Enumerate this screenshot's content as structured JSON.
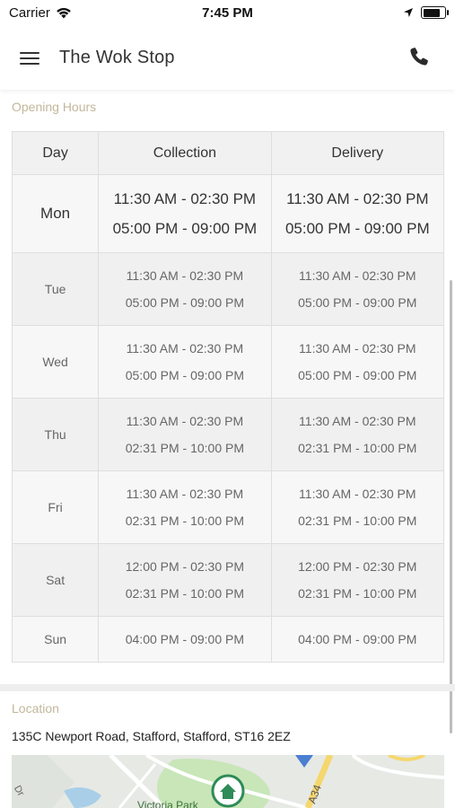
{
  "status_bar": {
    "carrier": "Carrier",
    "time": "7:45 PM",
    "battery_level": 0.9
  },
  "header": {
    "title": "The Wok Stop"
  },
  "opening_hours": {
    "label": "Opening Hours",
    "columns": [
      "Day",
      "Collection",
      "Delivery"
    ],
    "rows": [
      {
        "day": "Mon",
        "collection": [
          "11:30 AM - 02:30 PM",
          "05:00 PM - 09:00 PM"
        ],
        "delivery": [
          "11:30 AM - 02:30 PM",
          "05:00 PM - 09:00 PM"
        ]
      },
      {
        "day": "Tue",
        "collection": [
          "11:30 AM - 02:30 PM",
          "05:00 PM - 09:00 PM"
        ],
        "delivery": [
          "11:30 AM - 02:30 PM",
          "05:00 PM - 09:00 PM"
        ]
      },
      {
        "day": "Wed",
        "collection": [
          "11:30 AM - 02:30 PM",
          "05:00 PM - 09:00 PM"
        ],
        "delivery": [
          "11:30 AM - 02:30 PM",
          "05:00 PM - 09:00 PM"
        ]
      },
      {
        "day": "Thu",
        "collection": [
          "11:30 AM - 02:30 PM",
          "02:31 PM - 10:00 PM"
        ],
        "delivery": [
          "11:30 AM - 02:30 PM",
          "02:31 PM - 10:00 PM"
        ]
      },
      {
        "day": "Fri",
        "collection": [
          "11:30 AM - 02:30 PM",
          "02:31 PM - 10:00 PM"
        ],
        "delivery": [
          "11:30 AM - 02:30 PM",
          "02:31 PM - 10:00 PM"
        ]
      },
      {
        "day": "Sat",
        "collection": [
          "12:00 PM - 02:30 PM",
          "02:31 PM - 10:00 PM"
        ],
        "delivery": [
          "12:00 PM - 02:30 PM",
          "02:31 PM - 10:00 PM"
        ]
      },
      {
        "day": "Sun",
        "collection": [
          "04:00 PM - 09:00 PM"
        ],
        "delivery": [
          "04:00 PM - 09:00 PM"
        ]
      }
    ]
  },
  "location": {
    "label": "Location",
    "address": "135C Newport Road, Stafford, Stafford, ST16 2EZ",
    "map_labels": [
      "Victoria Park",
      "A34",
      "Dr"
    ]
  },
  "colors": {
    "section_label": "#c2b79a",
    "map_pin": "#2e8b57",
    "map_road": "#f5d76e",
    "map_water": "#a9cfe8",
    "map_park": "#c8e6b8"
  }
}
